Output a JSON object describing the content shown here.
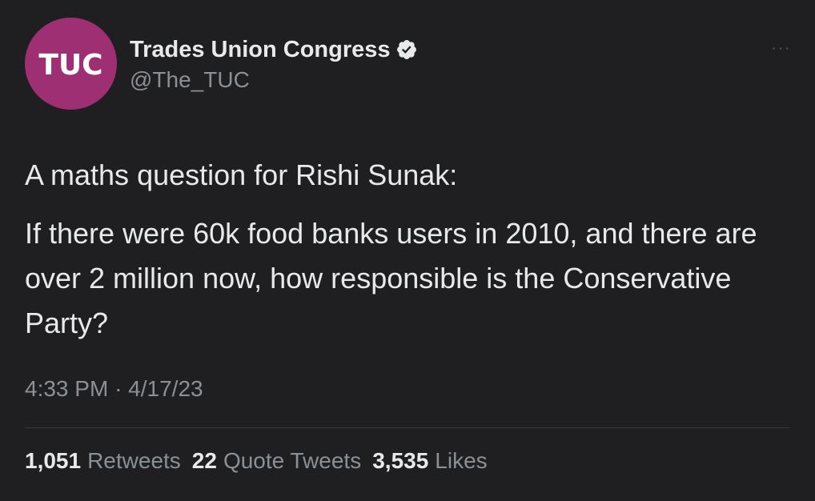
{
  "author": {
    "avatar_text": "TUC",
    "display_name": "Trades Union Congress",
    "handle": "@The_TUC",
    "verified": true,
    "avatar_color": "#9e2f72"
  },
  "tweet": {
    "line1": "A maths question for Rishi Sunak:",
    "line2": "If there were 60k food banks users in 2010, and there are over 2 million now, how responsible is the Conservative Party?",
    "time": "4:33 PM",
    "separator": "·",
    "date": "4/17/23"
  },
  "stats": {
    "retweets_count": "1,051",
    "retweets_label": "Retweets",
    "quotes_count": "22",
    "quotes_label": "Quote Tweets",
    "likes_count": "3,535",
    "likes_label": "Likes"
  },
  "icons": {
    "verified": "verified-badge-icon",
    "more": "more-options-icon"
  }
}
